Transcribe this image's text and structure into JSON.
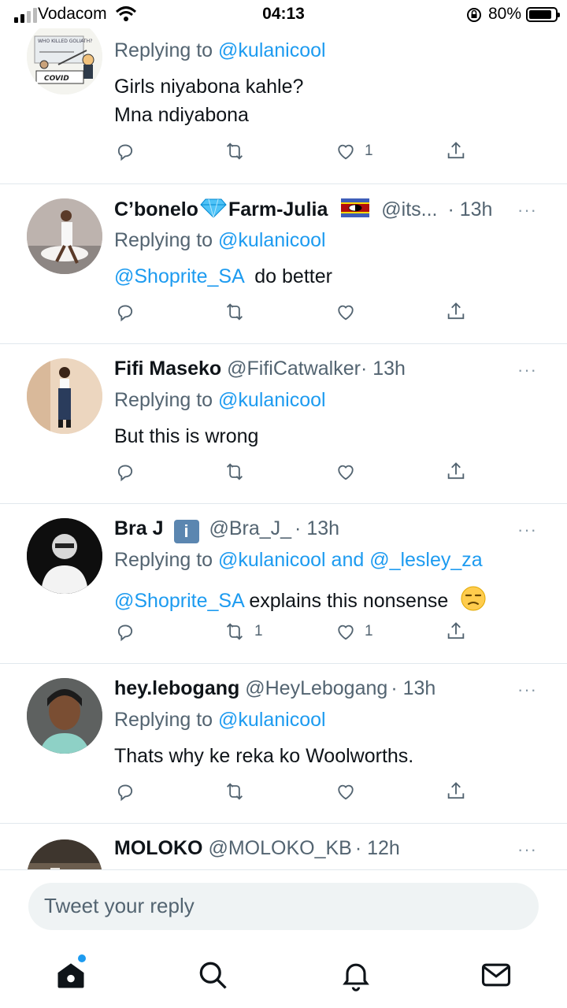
{
  "status_bar": {
    "carrier": "Vodacom",
    "time": "04:13",
    "battery": "80%"
  },
  "tweets": [
    {
      "replying_prefix": "Replying to ",
      "replying_to": "@kulanicool",
      "lines": [
        "Girls niyabona kahle?",
        "Mna ndiyabona"
      ],
      "like_count": "1"
    },
    {
      "name_part1": "C’bonelo",
      "name_part2": "Farm-Julia",
      "handle": "@its...",
      "time": "· 13h",
      "more": "···",
      "replying_prefix": "Replying to ",
      "replying_to": "@kulanicool",
      "mention": "@Shoprite_SA",
      "text": "  do better"
    },
    {
      "name": "Fifi Maseko",
      "handle": "@FifiCatwalker",
      "time": "· 13h",
      "more": "···",
      "replying_prefix": "Replying to ",
      "replying_to": "@kulanicool",
      "text": "But this is wrong"
    },
    {
      "name": "Bra J",
      "badge": "i",
      "handle": "@Bra_J_",
      "time": "· 13h",
      "more": "···",
      "replying_prefix": "Replying to ",
      "replying_to": "@kulanicool and @_lesley_za",
      "mention": "@Shoprite_SA",
      "text": " explains this nonsense",
      "retweet_count": "1",
      "like_count": "1"
    },
    {
      "name": "hey.lebogang",
      "handle": "@HeyLebogang",
      "time": "· 13h",
      "more": "···",
      "replying_prefix": "Replying to ",
      "replying_to": "@kulanicool",
      "text": "Thats why ke reka ko Woolworths."
    },
    {
      "name": "MOLOKO",
      "handle": "@MOLOKO_KB",
      "time": "· 12h",
      "more": "···"
    }
  ],
  "avatar_captions": {
    "covid_top": "WHO KILLED GOLIATH?",
    "covid_label": "COVID"
  },
  "compose": {
    "placeholder": "Tweet your reply"
  },
  "icons": {
    "reply": "reply-icon",
    "retweet": "retweet-icon",
    "like": "heart-icon",
    "share": "share-icon",
    "home": "home-icon",
    "search": "search-icon",
    "notifications": "bell-icon",
    "messages": "mail-icon"
  },
  "colors": {
    "accent": "#1d9bf0",
    "muted": "#536471",
    "text": "#0f1419"
  }
}
